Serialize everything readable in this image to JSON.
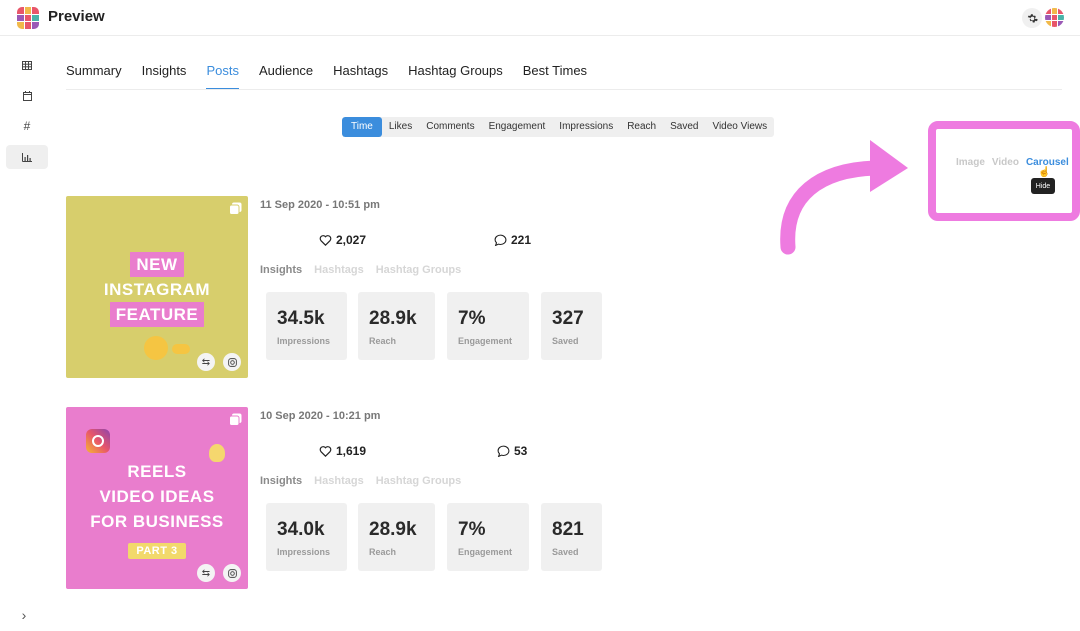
{
  "app": {
    "title": "Preview"
  },
  "colors": {
    "accent": "#3b8ddd",
    "highlight": "#ee7be0"
  },
  "sidebar": {
    "items": [
      {
        "icon": "grid-icon"
      },
      {
        "icon": "calendar-icon"
      },
      {
        "icon": "hashtag-icon",
        "glyph": "#"
      },
      {
        "icon": "bar-chart-icon"
      }
    ],
    "collapse_glyph": "›"
  },
  "tabs": [
    "Summary",
    "Insights",
    "Posts",
    "Audience",
    "Hashtags",
    "Hashtag Groups",
    "Best Times"
  ],
  "active_tab": "Posts",
  "sort": {
    "options": [
      "Time",
      "Likes",
      "Comments",
      "Engagement",
      "Impressions",
      "Reach",
      "Saved",
      "Video Views"
    ],
    "active": "Time"
  },
  "filters": {
    "options": [
      "Image",
      "Video",
      "Carousel"
    ],
    "active": "Carousel",
    "tooltip": "Hide"
  },
  "posts": [
    {
      "date": "11 Sep 2020 - 10:51 pm",
      "likes": "2,027",
      "comments": "221",
      "subtabs": [
        "Insights",
        "Hashtags",
        "Hashtag Groups"
      ],
      "thumb_lines": [
        "NEW",
        "INSTAGRAM",
        "FEATURE"
      ],
      "metrics": [
        {
          "value": "34.5k",
          "label": "Impressions"
        },
        {
          "value": "28.9k",
          "label": "Reach"
        },
        {
          "value": "7%",
          "label": "Engagement"
        },
        {
          "value": "327",
          "label": "Saved"
        }
      ]
    },
    {
      "date": "10 Sep 2020 - 10:21 pm",
      "likes": "1,619",
      "comments": "53",
      "subtabs": [
        "Insights",
        "Hashtags",
        "Hashtag Groups"
      ],
      "thumb_lines": [
        "REELS",
        "VIDEO IDEAS",
        "FOR BUSINESS",
        "PART 3"
      ],
      "metrics": [
        {
          "value": "34.0k",
          "label": "Impressions"
        },
        {
          "value": "28.9k",
          "label": "Reach"
        },
        {
          "value": "7%",
          "label": "Engagement"
        },
        {
          "value": "821",
          "label": "Saved"
        }
      ]
    }
  ]
}
